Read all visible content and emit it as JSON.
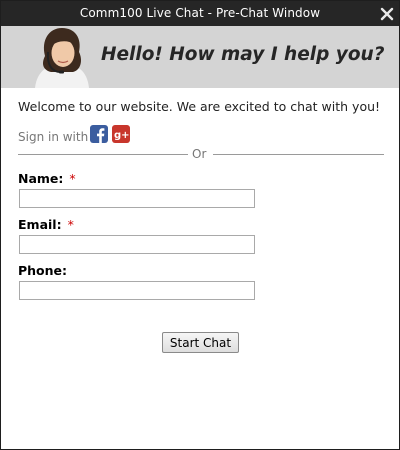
{
  "window": {
    "title": "Comm100 Live Chat - Pre-Chat Window",
    "close_icon": "close-icon"
  },
  "banner": {
    "greeting": "Hello! How may I help you?",
    "agent_image": "support-agent-avatar"
  },
  "welcome_text": "Welcome to our website. We are excited to chat with you!",
  "signin": {
    "label": "Sign in with",
    "providers": [
      {
        "name": "facebook",
        "icon": "facebook-icon",
        "color": "#3b5d9f"
      },
      {
        "name": "google-plus",
        "icon": "google-plus-icon",
        "color": "#c8362c"
      }
    ]
  },
  "divider": {
    "label": "Or"
  },
  "form": {
    "name": {
      "label": "Name:",
      "required_marker": "*",
      "value": ""
    },
    "email": {
      "label": "Email:",
      "required_marker": "*",
      "value": ""
    },
    "phone": {
      "label": "Phone:",
      "value": ""
    },
    "submit_label": "Start Chat"
  }
}
